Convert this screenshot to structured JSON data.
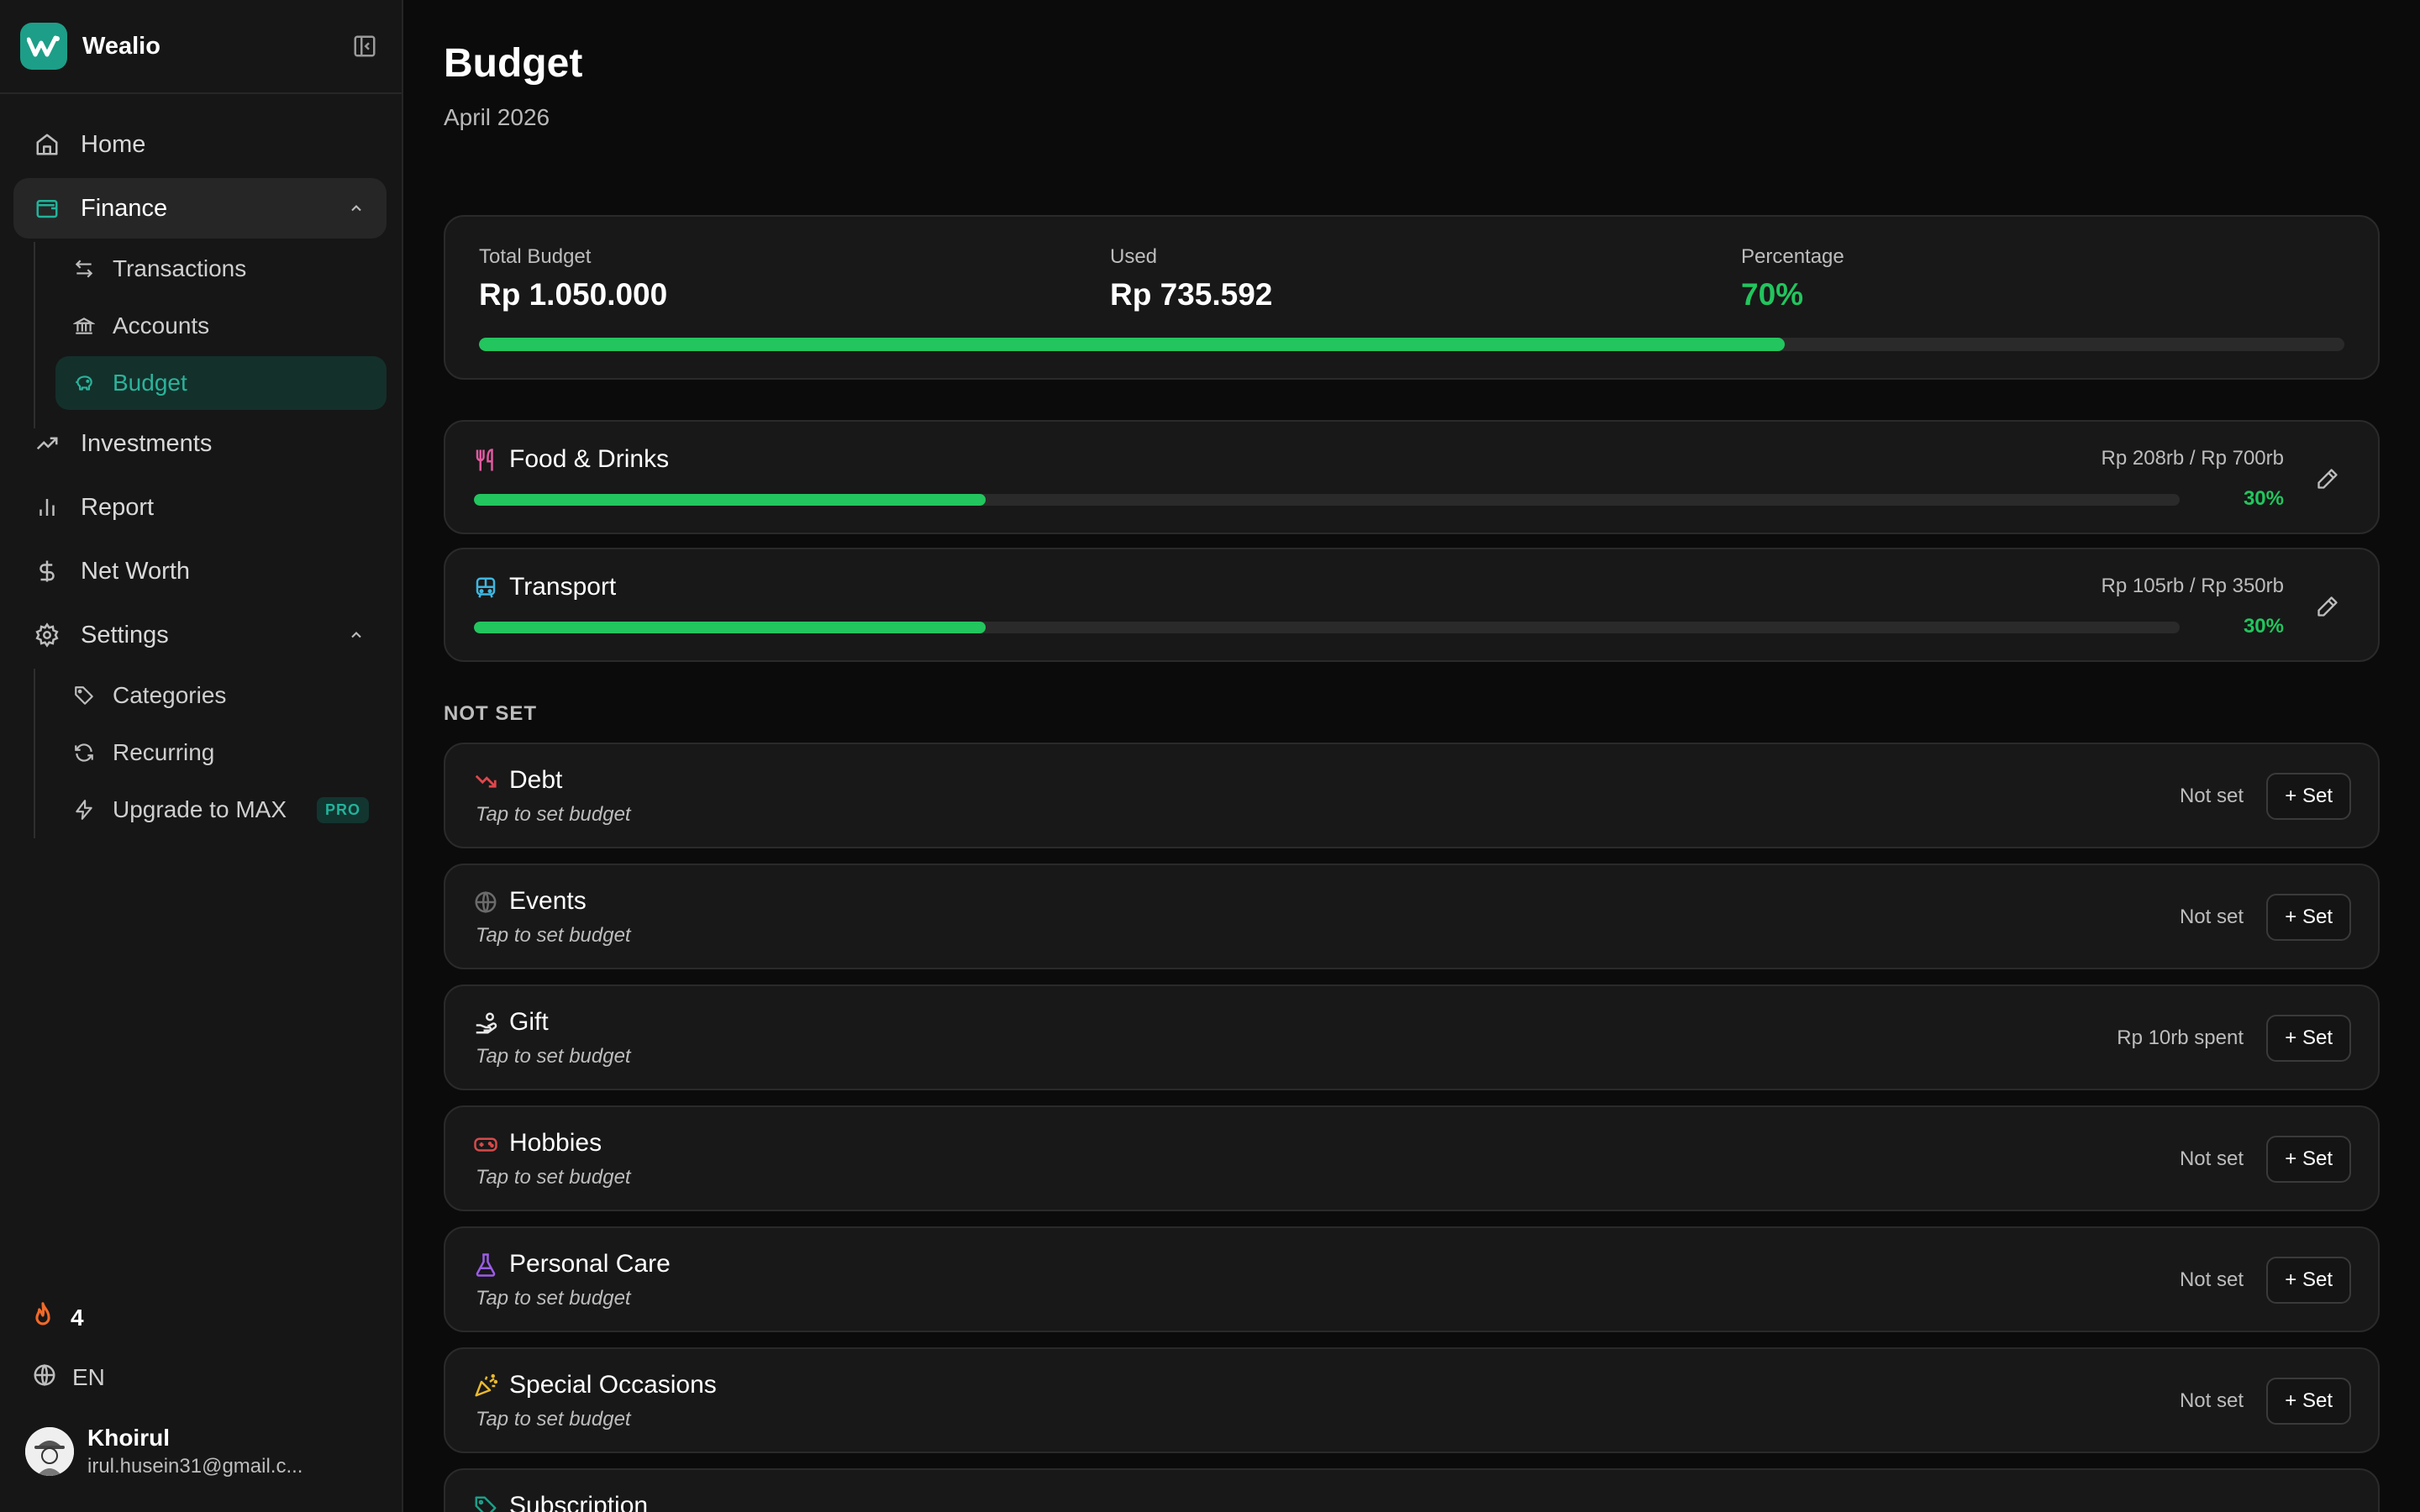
{
  "app": {
    "name": "Wealio",
    "accent": "#1d9e88"
  },
  "sidebar": {
    "home": "Home",
    "finance": "Finance",
    "transactions": "Transactions",
    "accounts": "Accounts",
    "budget": "Budget",
    "investments": "Investments",
    "report": "Report",
    "net_worth": "Net Worth",
    "settings": "Settings",
    "categories": "Categories",
    "recurring": "Recurring",
    "upgrade": "Upgrade to MAX",
    "pro_badge": "PRO",
    "streak_count": "4",
    "language": "EN",
    "user_name": "Khoirul",
    "user_email": "irul.husein31@gmail.c..."
  },
  "page": {
    "title": "Budget",
    "subtitle": "April 2026"
  },
  "summary": {
    "total_label": "Total Budget",
    "total_value": "Rp 1.050.000",
    "used_label": "Used",
    "used_value": "Rp 735.592",
    "percentage_label": "Percentage",
    "percentage_value": "70%",
    "progress_fraction": 0.7
  },
  "budgets": [
    {
      "name": "Food & Drinks",
      "amount": "Rp 208rb / Rp 700rb",
      "percent": "30%",
      "progress_fraction": 0.3,
      "icon": "utensils-icon",
      "icon_color": "#e05aa0"
    },
    {
      "name": "Transport",
      "amount": "Rp 105rb / Rp 350rb",
      "percent": "30%",
      "progress_fraction": 0.3,
      "icon": "bus-icon",
      "icon_color": "#3fb6e0"
    }
  ],
  "not_set": {
    "label": "NOT SET",
    "items": [
      {
        "name": "Debt",
        "hint": "Tap to set budget",
        "status": "Not set",
        "button": "+ Set",
        "icon": "trending-down-icon",
        "icon_color": "#e0474c"
      },
      {
        "name": "Events",
        "hint": "Tap to set budget",
        "status": "Not set",
        "button": "+ Set",
        "icon": "globe-icon",
        "icon_color": "#6b6b6b"
      },
      {
        "name": "Gift",
        "hint": "Tap to set budget",
        "status": "Rp 10rb spent",
        "button": "+ Set",
        "icon": "hand-coins-icon",
        "icon_color": "#e8e8e8"
      },
      {
        "name": "Hobbies",
        "hint": "Tap to set budget",
        "status": "Not set",
        "button": "+ Set",
        "icon": "gamepad-icon",
        "icon_color": "#d64a4a"
      },
      {
        "name": "Personal Care",
        "hint": "Tap to set budget",
        "status": "Not set",
        "button": "+ Set",
        "icon": "flask-icon",
        "icon_color": "#9b5de5"
      },
      {
        "name": "Special Occasions",
        "hint": "Tap to set budget",
        "status": "Not set",
        "button": "+ Set",
        "icon": "party-popper-icon",
        "icon_color": "#e8b92f"
      },
      {
        "name": "Subscription",
        "hint": "",
        "status": "",
        "button": "",
        "icon": "tag-icon",
        "icon_color": "#1d9e88"
      }
    ]
  }
}
